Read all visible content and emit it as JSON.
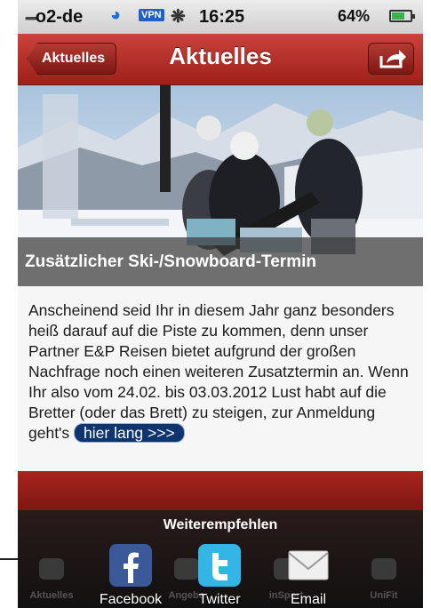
{
  "status_bar": {
    "carrier": "o2-de",
    "vpn": "VPN",
    "time": "16:25",
    "battery": "64%",
    "battery_level": 0.64
  },
  "navbar": {
    "back_label": "Aktuelles",
    "title": "Aktuelles",
    "share_icon": "share-arrow-icon"
  },
  "hero": {
    "caption": "Zusätzlicher Ski-/Snowboard-Termin"
  },
  "article": {
    "body": "Anscheinend seid Ihr in diesem Jahr ganz besonders heiß darauf auf die Piste zu kommen, denn unser Partner E&P Reisen bietet aufgrund der großen Nachfrage noch einen weiteren Zusatztermin an. Wenn Ihr also vom 24.02. bis 03.03.2012 Lust habt auf die Bretter (oder das Brett) zu steigen, zur Anmeldung geht's",
    "link": "hier lang >>>"
  },
  "share_sheet": {
    "title": "Weiterempfehlen",
    "options": [
      {
        "label": "Facebook",
        "icon": "facebook-icon",
        "color": "#3b5998"
      },
      {
        "label": "Twitter",
        "icon": "twitter-icon",
        "color": "#33b5e5"
      },
      {
        "label": "Email",
        "icon": "email-icon",
        "color": "#e8e8e8"
      }
    ]
  },
  "tab_bar": {
    "tabs": [
      {
        "label": "Aktuelles"
      },
      {
        "label": "Angebo"
      },
      {
        "label": "inSport"
      },
      {
        "label": "UniFit"
      }
    ]
  }
}
